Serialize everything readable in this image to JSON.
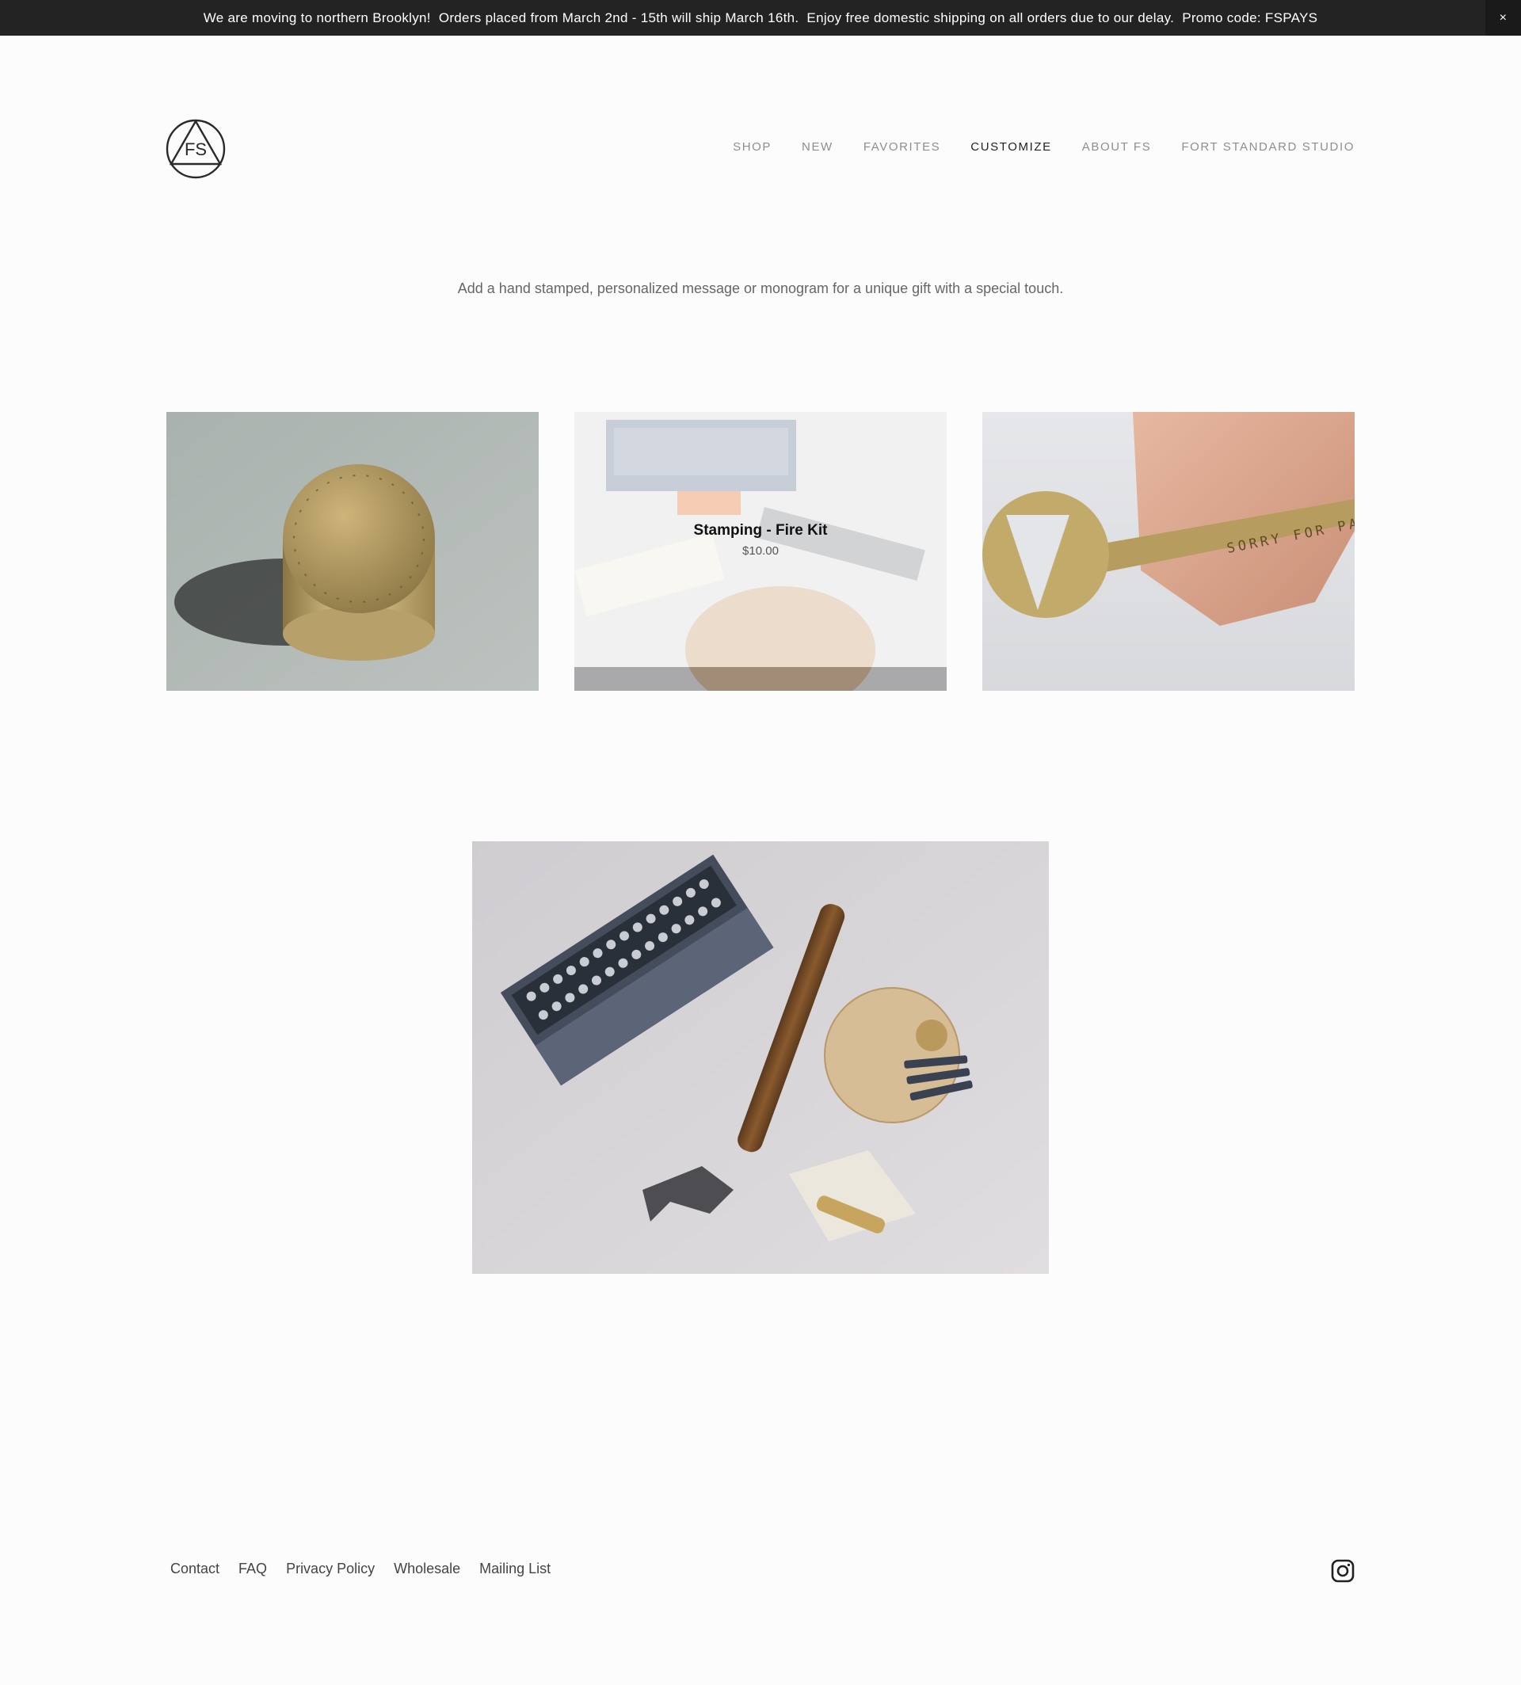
{
  "announcement": {
    "message": "We are moving to northern Brooklyn!  Orders placed from March 2nd - 15th will ship March 16th.  Enjoy free domestic shipping on all orders due to our delay.  Promo code: FSPAYS",
    "close_label": "×"
  },
  "logo": {
    "text": "FS"
  },
  "nav": [
    {
      "label": "SHOP"
    },
    {
      "label": "NEW"
    },
    {
      "label": "FAVORITES"
    },
    {
      "label": "CUSTOMIZE",
      "active": true
    },
    {
      "label": "ABOUT FS"
    },
    {
      "label": "FORT STANDARD STUDIO"
    }
  ],
  "intro": {
    "text": "Add a hand stamped, personalized message or monogram for a unique gift with a special touch."
  },
  "products": [
    {
      "name": "brass-canister"
    },
    {
      "name": "Stamping - Fire Kit",
      "price": "$10.00"
    },
    {
      "name": "bottle-opener",
      "engraving": "SORRY FOR PARTYING"
    }
  ],
  "footer": {
    "links": [
      "Contact",
      "FAQ",
      "Privacy Policy",
      "Wholesale",
      "Mailing List"
    ],
    "social_icon": "instagram-icon"
  }
}
